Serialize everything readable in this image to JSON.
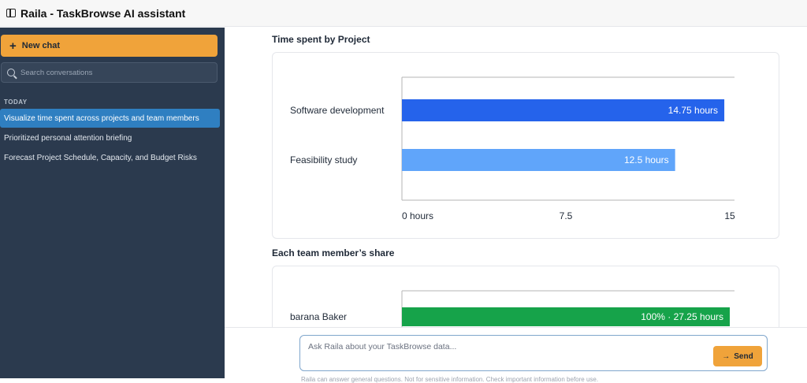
{
  "window": {
    "title": "Raila - TaskBrowse AI assistant"
  },
  "sidebar": {
    "new_chat_label": "New chat",
    "search_placeholder": "Search conversations",
    "section_label": "TODAY",
    "conversations": [
      {
        "label": "Visualize time spent across projects and team members",
        "active": true
      },
      {
        "label": "Prioritized personal attention briefing",
        "active": false
      },
      {
        "label": "Forecast Project Schedule, Capacity, and Budget Risks",
        "active": false
      }
    ]
  },
  "main": {
    "chart1_title": "Time spent by Project",
    "chart2_title": "Each team member’s share"
  },
  "chart_data": [
    {
      "type": "bar",
      "orientation": "horizontal",
      "title": "Time spent by Project",
      "categories": [
        "Software development",
        "Feasibility study"
      ],
      "values": [
        14.75,
        12.5
      ],
      "data_labels": [
        "14.75 hours",
        "12.5 hours"
      ],
      "colors": [
        "#2563eb",
        "#60a5fa"
      ],
      "xlim": [
        0,
        15
      ],
      "x_ticks": [
        0,
        7.5,
        15
      ],
      "x_tick_labels": [
        "0 hours",
        "7.5",
        "15"
      ]
    },
    {
      "type": "bar",
      "orientation": "horizontal",
      "title": "Each team member’s share",
      "categories": [
        "barana Baker"
      ],
      "values": [
        100
      ],
      "data_labels": [
        "100% · 27.25 hours"
      ],
      "colors": [
        "#16a34a"
      ],
      "xlim": [
        0,
        100
      ]
    }
  ],
  "composer": {
    "placeholder": "Ask Raila about your TaskBrowse data...",
    "send_label": "Send",
    "footnote": "Raila can answer general questions. Not for sensitive information. Check important information before use."
  },
  "colors": {
    "sidebar_bg": "#2b3a4e",
    "accent": "#f0a33a",
    "active_item": "#2f7fc1"
  }
}
